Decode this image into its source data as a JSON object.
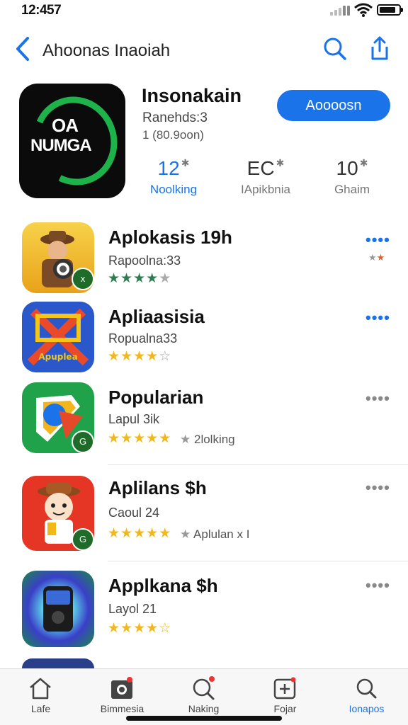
{
  "status": {
    "time": "12:457"
  },
  "nav": {
    "title": "Ahoonas Inaoiah"
  },
  "app": {
    "icon_line1": "OA",
    "icon_line2": "NUMGA",
    "name": "Insonakain",
    "subtitle": "Ranehds:3",
    "size": "1 (80.9oon)",
    "get_label": "Aoooosn",
    "stats": [
      {
        "value": "12",
        "label": "Noolking"
      },
      {
        "value": "EC",
        "label": "IApikbnia"
      },
      {
        "value": "10",
        "label": "Ghaim"
      }
    ]
  },
  "list": [
    {
      "name": "Aplokasis 19h",
      "category": "Rapoolna:33",
      "stars": 4,
      "star_color": "green",
      "extra": "",
      "more": "••••",
      "more_color": "blue",
      "badge": "x"
    },
    {
      "name": "Apliaasisia",
      "category": "Ropualna33",
      "stars": 4,
      "star_color": "gold",
      "extra": "",
      "more": "••••",
      "more_color": "blue",
      "badge": ""
    },
    {
      "name": "Popularian",
      "category": "Lapul 3ik",
      "stars": 5,
      "star_color": "gold",
      "extra": "2lolking",
      "more": "••••",
      "more_color": "gray",
      "badge": "G"
    },
    {
      "name": "Aplilans $h",
      "category": "Caoul 24",
      "stars": 5,
      "star_color": "gold",
      "extra": "Aplulan x I",
      "more": "••••",
      "more_color": "gray",
      "badge": "G"
    },
    {
      "name": "Applkana $h",
      "category": "Layol 21",
      "stars": 4,
      "star_color": "gold",
      "extra": "",
      "more": "••••",
      "more_color": "gray",
      "badge": ""
    }
  ],
  "tabs": [
    {
      "label": "Lafe",
      "icon": "home-icon"
    },
    {
      "label": "Bimmesia",
      "icon": "camera-icon"
    },
    {
      "label": "Naking",
      "icon": "search-badge-icon"
    },
    {
      "label": "Fojar",
      "icon": "plus-box-icon"
    },
    {
      "label": "Ionapos",
      "icon": "search-icon"
    }
  ],
  "colors": {
    "accent": "#1a73e8",
    "star": "#f2b81a",
    "star_green": "#2e7d4f"
  }
}
